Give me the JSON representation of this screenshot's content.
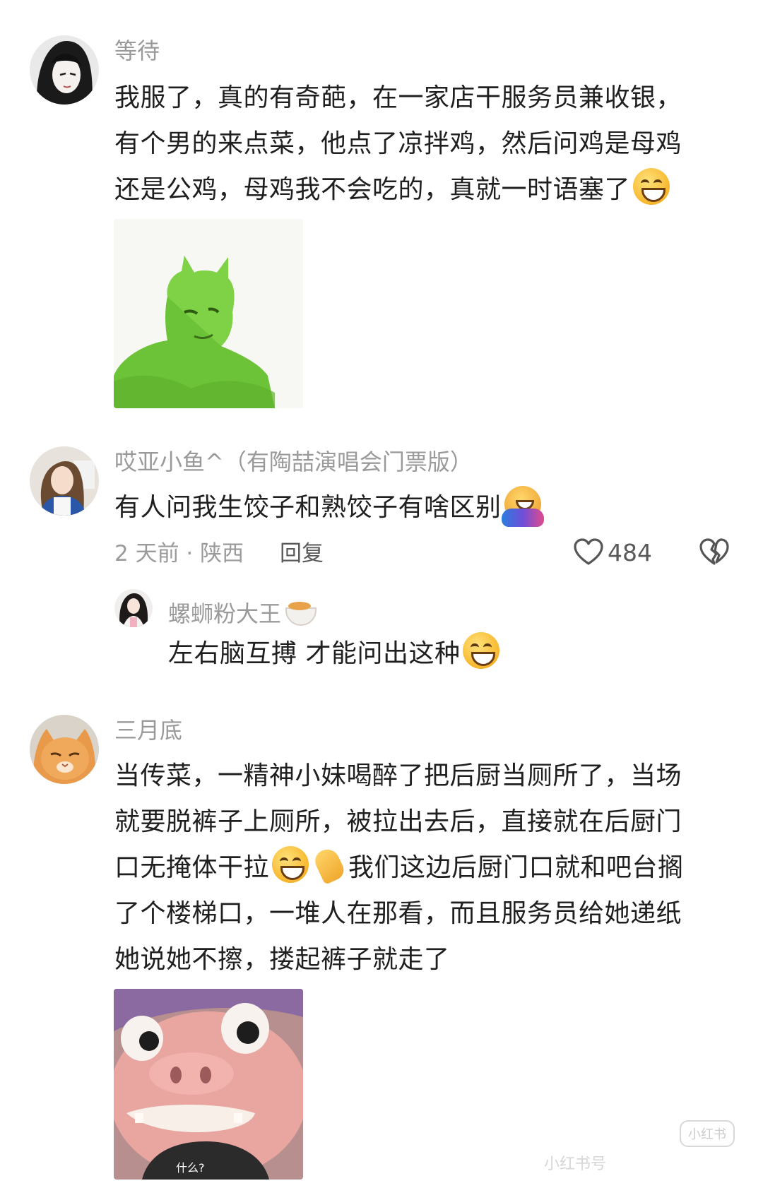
{
  "comments": [
    {
      "username": "等待",
      "lines": [
        "我服了，真的有奇葩，在一家店干服务员兼收银，",
        "有个男的来点菜，他点了凉拌鸡，然后问鸡是母鸡",
        "还是公鸡，母鸡我不会吃的，真就一时语塞了"
      ],
      "emoji": "grin-emoji",
      "sticker": "green-cartoon-meme-sticker"
    },
    {
      "username": "哎亚小鱼^（有陶喆演唱会门票版）",
      "lines": [
        "有人问我生饺子和熟饺子有啥区别"
      ],
      "emoji": "hug-emoji",
      "time_location": "2 天前 · 陕西",
      "reply_label": "回复",
      "like_count": "484",
      "reply": {
        "username": "螺蛳粉大王",
        "username_emoji": "noodle-bowl-emoji",
        "text": "左右脑互搏 才能问出这种",
        "emoji": "grin-emoji"
      }
    },
    {
      "username": "三月底",
      "lines": [
        "当传菜，一精神小妹喝醉了把后厨当厕所了，当场",
        "就要脱裤子上厕所，被拉出去后，直接就在后厨门",
        "口无掩体干拉",
        "我们这边后厨门口就和吧台搁",
        "了个楼梯口，一堆人在那看，而且服务员给她递纸",
        "她说她不擦，搂起裤子就走了"
      ],
      "emojis": [
        "grin-emoji",
        "clap-emoji"
      ],
      "sticker": "pig-cartoon-meme-sticker",
      "sticker_caption": "什么?"
    }
  ],
  "watermark": {
    "badge": "小红书",
    "text": "小红书号"
  }
}
